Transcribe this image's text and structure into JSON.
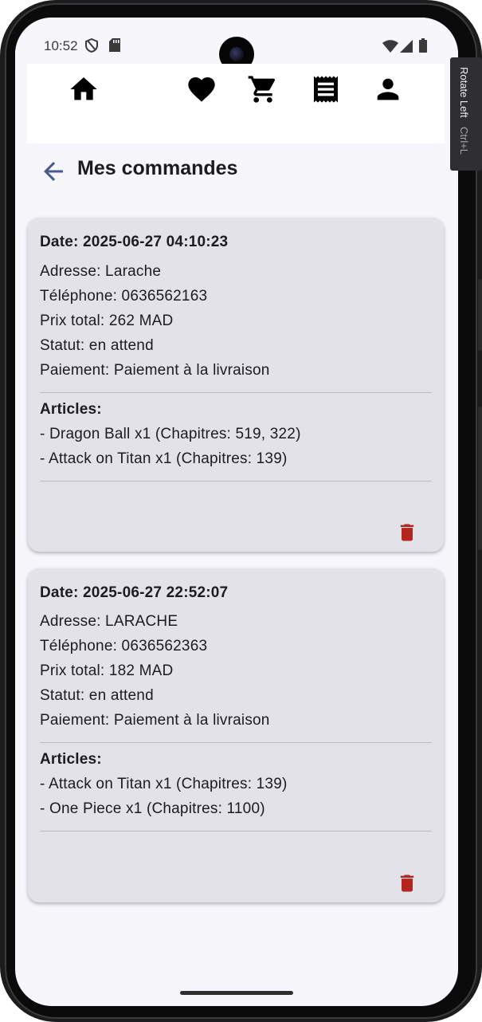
{
  "status_bar": {
    "time": "10:52",
    "icons": [
      "shield-icon",
      "sd-card-icon",
      "wifi-icon",
      "cellular-icon",
      "battery-icon"
    ]
  },
  "top_nav": {
    "items": [
      "home-icon",
      "favorites-heart-icon",
      "cart-icon",
      "orders-receipt-icon",
      "profile-icon"
    ]
  },
  "header": {
    "title": "Mes commandes"
  },
  "orders": [
    {
      "date": "Date: 2025-06-27 04:10:23",
      "address": "Adresse: Larache",
      "phone": "Téléphone: 0636562163",
      "total": "Prix total: 262 MAD",
      "status": "Statut: en attend",
      "payment": "Paiement: Paiement à la livraison",
      "articles_title": "Articles:",
      "articles": [
        "- Dragon Ball x1 (Chapitres: 519, 322)",
        "- Attack on Titan x1 (Chapitres: 139)"
      ]
    },
    {
      "date": "Date: 2025-06-27 22:52:07",
      "address": "Adresse: LARACHE",
      "phone": "Téléphone: 0636562363",
      "total": "Prix total: 182 MAD",
      "status": "Statut: en attend",
      "payment": "Paiement: Paiement à la livraison",
      "articles_title": "Articles:",
      "articles": [
        "- Attack on Titan x1 (Chapitres: 139)",
        "- One Piece x1 (Chapitres: 1100)"
      ]
    }
  ],
  "emulator_tooltip": {
    "label": "Rotate Left",
    "shortcut": "Ctrl+L"
  },
  "colors": {
    "card_background": "#e3e2e8",
    "page_background": "#f6f6fb",
    "delete_icon": "#b3261e",
    "back_arrow": "#4a5a8c",
    "text": "#1d1b20"
  }
}
